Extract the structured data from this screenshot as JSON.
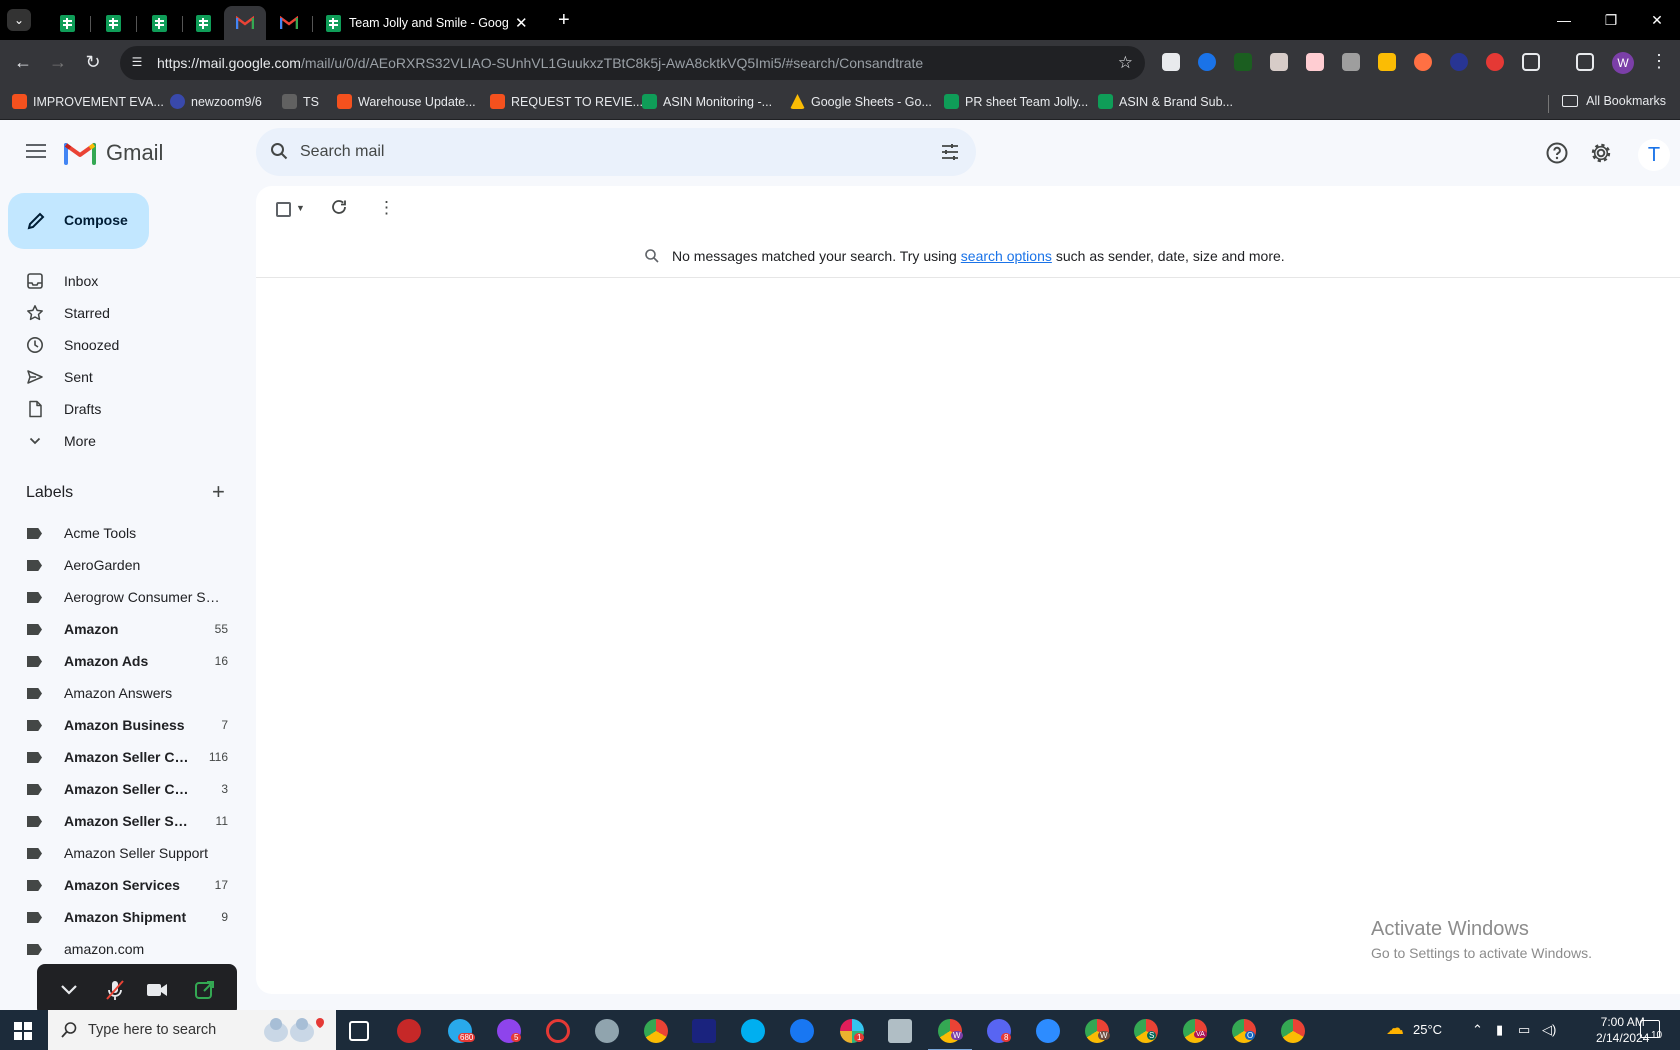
{
  "browser": {
    "active_tab_title": "Team Jolly and Smile - Google Sheets",
    "url_host": "https://mail.google.com",
    "url_path": "/mail/u/0/d/AEoRXRS32VLIAO-SUnhVL1GuukxzTBtC8k5j-AwA8cktkVQ5Imi5/#search/Consandtrate",
    "bookmarks": [
      {
        "label": "IMPROVEMENT EVA...",
        "color": "#f4511e"
      },
      {
        "label": "newzoom9/6",
        "color": "#3949ab"
      },
      {
        "label": "TS",
        "color": "#9e9e9e"
      },
      {
        "label": "Warehouse Update...",
        "color": "#f4511e"
      },
      {
        "label": "REQUEST TO REVIE...",
        "color": "#f4511e"
      },
      {
        "label": "ASIN Monitoring -...",
        "color": "#0f9d58"
      },
      {
        "label": "Google Sheets - Go...",
        "color": "#fbbc04"
      },
      {
        "label": "PR sheet Team Jolly...",
        "color": "#0f9d58"
      },
      {
        "label": "ASIN & Brand Sub...",
        "color": "#0f9d58"
      }
    ],
    "all_bookmarks": "All Bookmarks",
    "profile_initial": "W"
  },
  "gmail": {
    "logo_text": "Gmail",
    "search_placeholder": "Search mail",
    "avatar_initial": "T",
    "compose_label": "Compose",
    "nav": [
      {
        "label": "Inbox",
        "icon": "inbox-icon"
      },
      {
        "label": "Starred",
        "icon": "star-icon"
      },
      {
        "label": "Snoozed",
        "icon": "clock-icon"
      },
      {
        "label": "Sent",
        "icon": "send-icon"
      },
      {
        "label": "Drafts",
        "icon": "draft-icon"
      },
      {
        "label": "More",
        "icon": "chevron-down-icon"
      }
    ],
    "labels_title": "Labels",
    "labels": [
      {
        "name": "Acme Tools",
        "count": "",
        "bold": false
      },
      {
        "name": "AeroGarden",
        "count": "",
        "bold": false
      },
      {
        "name": "Aerogrow Consumer Se...",
        "count": "",
        "bold": false
      },
      {
        "name": "Amazon",
        "count": "55",
        "bold": true
      },
      {
        "name": "Amazon Ads",
        "count": "16",
        "bold": true
      },
      {
        "name": "Amazon Answers",
        "count": "",
        "bold": false
      },
      {
        "name": "Amazon Business",
        "count": "7",
        "bold": true
      },
      {
        "name": "Amazon Seller Cn...",
        "count": "116",
        "bold": true
      },
      {
        "name": "Amazon Seller Cntr...",
        "count": "3",
        "bold": true
      },
      {
        "name": "Amazon Seller Serv.",
        "count": "11",
        "bold": true
      },
      {
        "name": "Amazon Seller Support",
        "count": "",
        "bold": false
      },
      {
        "name": "Amazon Services",
        "count": "17",
        "bold": true
      },
      {
        "name": "Amazon Shipment",
        "count": "9",
        "bold": true
      },
      {
        "name": "amazon.com",
        "count": "",
        "bold": false
      }
    ],
    "empty": {
      "before": "No messages matched your search. Try using",
      "link": "search options",
      "after": "such as sender, date, size and more."
    }
  },
  "watermark": {
    "line1": "Activate Windows",
    "line2": "Go to Settings to activate Windows."
  },
  "taskbar": {
    "search_text": "Type here to search",
    "temperature": "25°C",
    "time": "7:00 AM",
    "date": "2/14/2024",
    "notification_count": "10",
    "badges": {
      "telegram": "680",
      "messenger": "5",
      "slack": "1",
      "discord": "8",
      "chrome_w": "W",
      "chrome_s": "S",
      "chrome_va": "VA",
      "chrome_o": "O"
    }
  }
}
